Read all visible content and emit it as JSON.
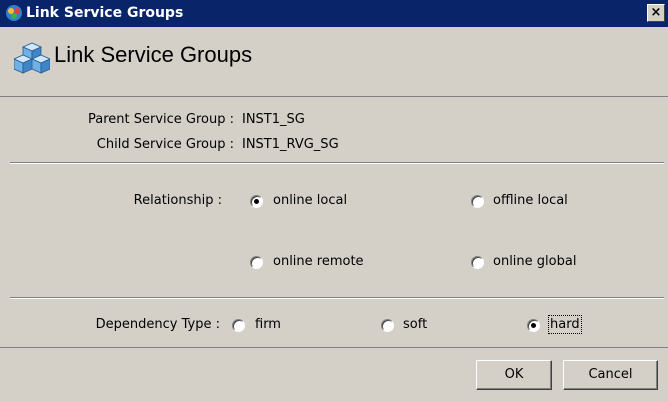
{
  "window": {
    "title": "Link Service Groups",
    "close_glyph": "×"
  },
  "header": {
    "title": "Link Service Groups"
  },
  "info": {
    "parent_label": "Parent Service Group :",
    "parent_value": "INST1_SG",
    "child_label": "Child Service Group :",
    "child_value": "INST1_RVG_SG"
  },
  "relationship": {
    "label": "Relationship :",
    "options": [
      {
        "label": "online local",
        "checked": true
      },
      {
        "label": "offline local",
        "checked": false
      },
      {
        "label": "online remote",
        "checked": false
      },
      {
        "label": "online global",
        "checked": false
      }
    ]
  },
  "dependency": {
    "label": "Dependency Type :",
    "options": [
      {
        "label": "firm",
        "checked": false
      },
      {
        "label": "soft",
        "checked": false
      },
      {
        "label": "hard",
        "checked": true
      }
    ]
  },
  "buttons": {
    "ok": "OK",
    "cancel": "Cancel"
  },
  "colors": {
    "titlebar": "#0a246a",
    "dialog_bg": "#d4d0c8"
  },
  "icons": {
    "title": "service-group-icon",
    "header": "service-group-cubes-icon"
  }
}
